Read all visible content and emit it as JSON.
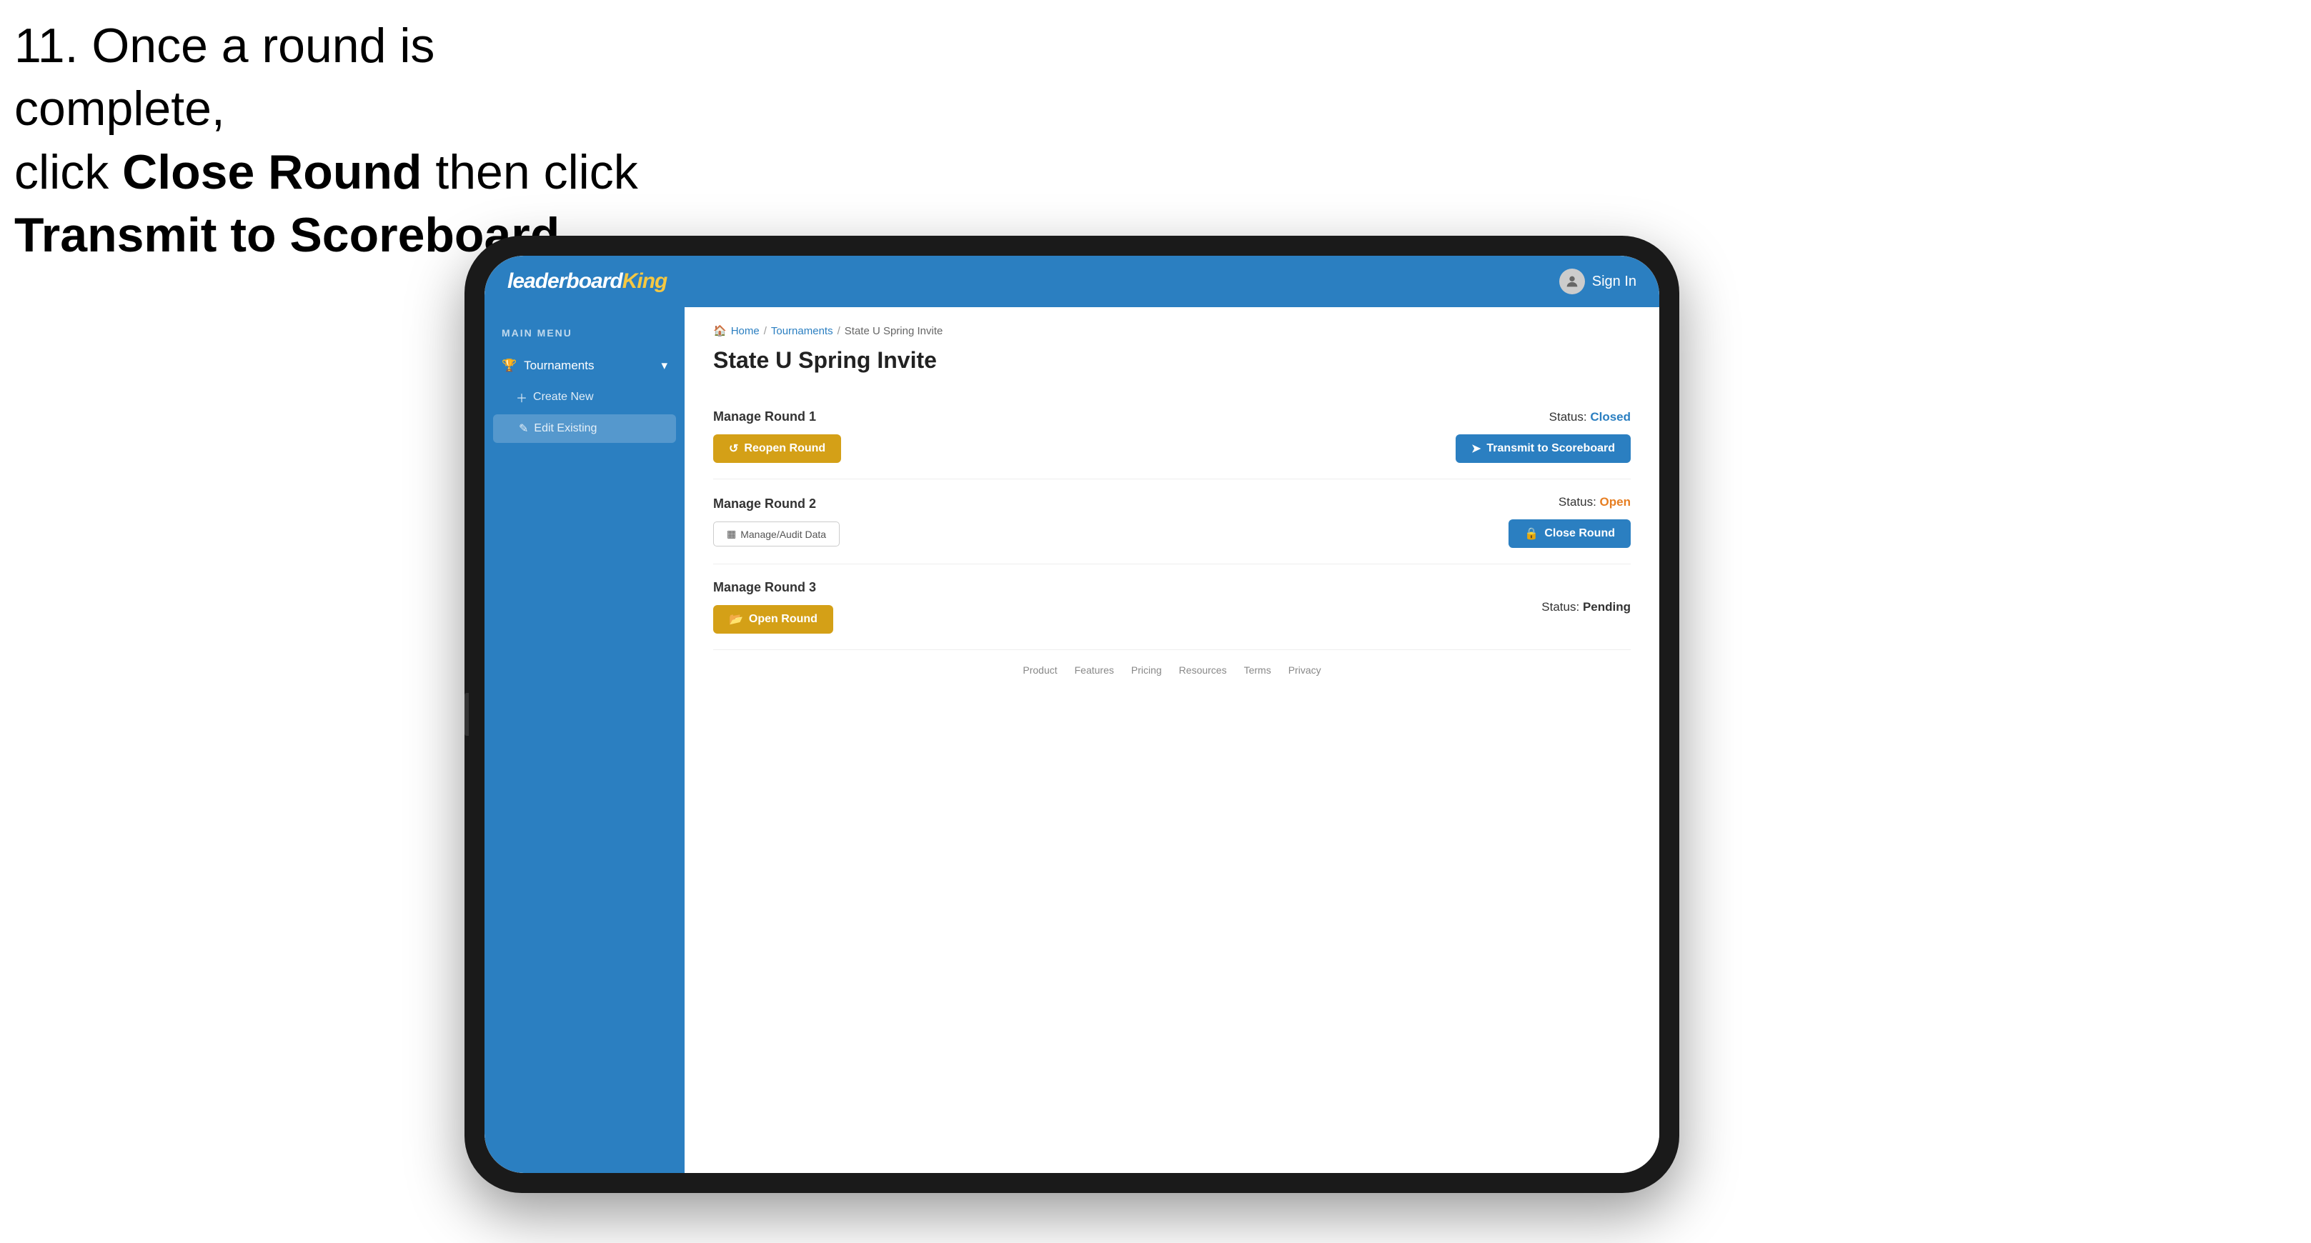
{
  "instruction": {
    "line1": "11. Once a round is complete,",
    "line2_pre": "click ",
    "line2_bold": "Close Round",
    "line2_post": " then click",
    "line3": "Transmit to Scoreboard."
  },
  "app": {
    "logo": {
      "text_plain": "leaderboard",
      "text_accent": "King"
    },
    "signin": {
      "label": "Sign In"
    }
  },
  "sidebar": {
    "menu_label": "MAIN MENU",
    "items": [
      {
        "id": "tournaments",
        "label": "Tournaments",
        "icon": "trophy"
      },
      {
        "id": "create-new",
        "label": "Create New",
        "icon": "plus"
      },
      {
        "id": "edit-existing",
        "label": "Edit Existing",
        "icon": "edit"
      }
    ]
  },
  "breadcrumb": {
    "home": "Home",
    "sep1": "/",
    "tournaments": "Tournaments",
    "sep2": "/",
    "current": "State U Spring Invite"
  },
  "page": {
    "title": "State U Spring Invite",
    "rounds": [
      {
        "id": "round1",
        "title": "Manage Round 1",
        "status_label": "Status:",
        "status_value": "Closed",
        "status_type": "closed",
        "buttons": [
          {
            "id": "reopen",
            "label": "Reopen Round",
            "style": "amber",
            "icon": "refresh"
          },
          {
            "id": "transmit",
            "label": "Transmit to Scoreboard",
            "style": "blue",
            "icon": "send"
          }
        ]
      },
      {
        "id": "round2",
        "title": "Manage Round 2",
        "status_label": "Status:",
        "status_value": "Open",
        "status_type": "open",
        "buttons": [
          {
            "id": "manage-audit",
            "label": "Manage/Audit Data",
            "style": "outline",
            "icon": "table"
          },
          {
            "id": "close-round",
            "label": "Close Round",
            "style": "blue",
            "icon": "lock"
          }
        ]
      },
      {
        "id": "round3",
        "title": "Manage Round 3",
        "status_label": "Status:",
        "status_value": "Pending",
        "status_type": "pending",
        "buttons": [
          {
            "id": "open-round",
            "label": "Open Round",
            "style": "amber",
            "icon": "folder-open"
          }
        ]
      }
    ]
  },
  "footer": {
    "links": [
      "Product",
      "Features",
      "Pricing",
      "Resources",
      "Terms",
      "Privacy"
    ]
  },
  "colors": {
    "blue": "#2b7fc1",
    "amber": "#d4a017",
    "closed": "#2b7fc1",
    "open": "#e67e22",
    "pending": "#333"
  }
}
